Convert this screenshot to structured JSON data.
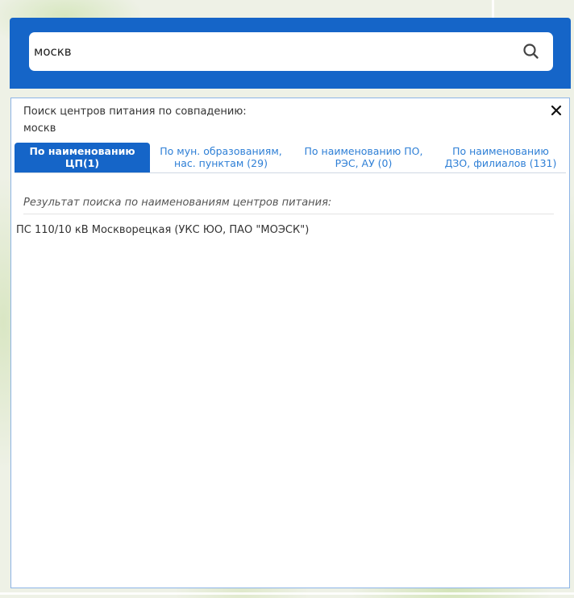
{
  "search": {
    "value": "москв"
  },
  "panel": {
    "title": "Поиск центров питания по совпадению:",
    "query": "москв"
  },
  "tabs": [
    {
      "line1": "По наименованию",
      "line2": "ЦП(1)",
      "active": true
    },
    {
      "line1": "По мун. образованиям,",
      "line2": "нас. пунктам (29)",
      "active": false
    },
    {
      "line1": "По наименованию ПО,",
      "line2": "РЭС, АУ (0)",
      "active": false
    },
    {
      "line1": "По наименованию",
      "line2": "ДЗО, филиалов (131)",
      "active": false
    }
  ],
  "results": {
    "heading": "Результат поиска по наименованиям центров питания:",
    "items": [
      "ПС 110/10 кВ Москворецкая (УКС ЮО, ПАО \"МОЭСК\")"
    ]
  },
  "icons": {
    "search": "search-icon",
    "close": "close-icon"
  },
  "colors": {
    "header_blue": "#1565c8",
    "tab_link": "#2e7fd6",
    "panel_border": "#8cb4e6"
  }
}
